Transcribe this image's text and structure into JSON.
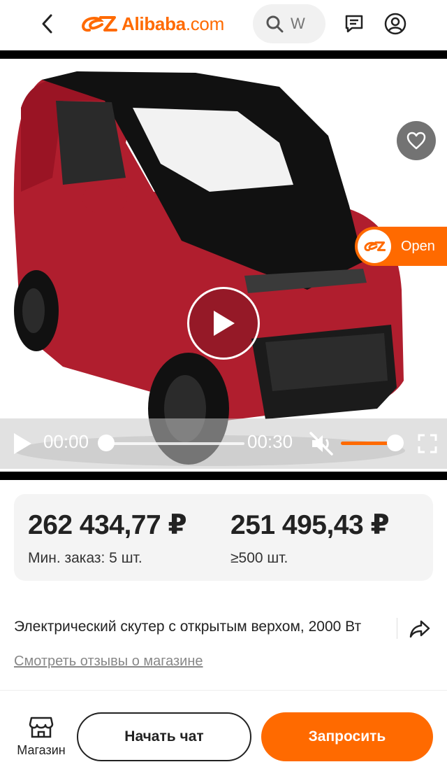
{
  "header": {
    "logo_brand": "Alibaba",
    "logo_domain": ".com",
    "search_placeholder": "W",
    "brand_color": "#ff6a00"
  },
  "media": {
    "image_alt": "Red and black compact electric car",
    "open_label": "Open",
    "current_time": "00:00",
    "duration": "00:30",
    "progress": 0,
    "volume": 1.0,
    "muted": true
  },
  "pricing": {
    "tiers": [
      {
        "price": "262 434,77 ₽",
        "moq": "Мин. заказ: 5 шт."
      },
      {
        "price": "251 495,43 ₽",
        "moq": "≥500 шт."
      }
    ]
  },
  "product": {
    "title": "Электрический скутер с открытым верхом, 2000 Вт",
    "reviews_link": "Смотреть отзывы о магазине"
  },
  "bottom_bar": {
    "store_label": "Магазин",
    "chat_label": "Начать чат",
    "request_label": "Запросить"
  }
}
